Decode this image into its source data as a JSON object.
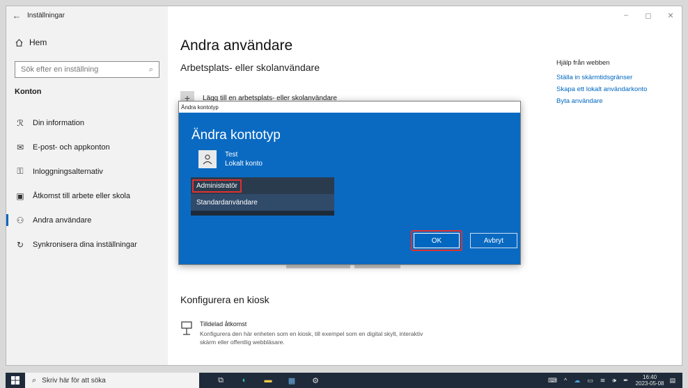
{
  "window": {
    "title": "Inställningar",
    "controls": [
      "–",
      "◻",
      "✕"
    ]
  },
  "sidebar": {
    "home": "Hem",
    "search_placeholder": "Sök efter en inställning",
    "section": "Konton",
    "items": [
      {
        "label": "Din information",
        "icon": "person-card-icon"
      },
      {
        "label": "E-post- och appkonton",
        "icon": "mail-icon"
      },
      {
        "label": "Inloggningsalternativ",
        "icon": "key-icon"
      },
      {
        "label": "Åtkomst till arbete eller skola",
        "icon": "briefcase-icon"
      },
      {
        "label": "Andra användare",
        "icon": "people-icon",
        "active": true
      },
      {
        "label": "Synkronisera dina inställningar",
        "icon": "sync-icon"
      }
    ]
  },
  "main": {
    "title": "Andra användare",
    "subhead": "Arbetsplats- eller skolanvändare",
    "add_label": "Lägg till en arbetsplats- eller skolanvändare",
    "kiosk_title": "Konfigurera en kiosk",
    "kiosk_item_title": "Tilldelad åtkomst",
    "kiosk_item_desc": "Konfigurera den här enheten som en kiosk, till exempel som en digital skylt, interaktiv skärm eller offentlig webbläsare."
  },
  "help": {
    "title": "Hjälp från webben",
    "links": [
      "Ställa in skärmtidsgränser",
      "Skapa ett lokalt användarkonto",
      "Byta användare"
    ]
  },
  "dialog": {
    "window_title": "Ändra kontotyp",
    "heading": "Ändra kontotyp",
    "user_name": "Test",
    "user_type": "Lokalt konto",
    "options": [
      "Administratör",
      "Standardanvändare"
    ],
    "ok": "OK",
    "cancel": "Avbryt"
  },
  "taskbar": {
    "search_placeholder": "Skriv här för att söka",
    "time": "16:40",
    "date": "2023-05-08"
  },
  "colors": {
    "accent": "#0067c0",
    "dialog_bg": "#0a6ac2",
    "highlight": "#e0312f"
  }
}
